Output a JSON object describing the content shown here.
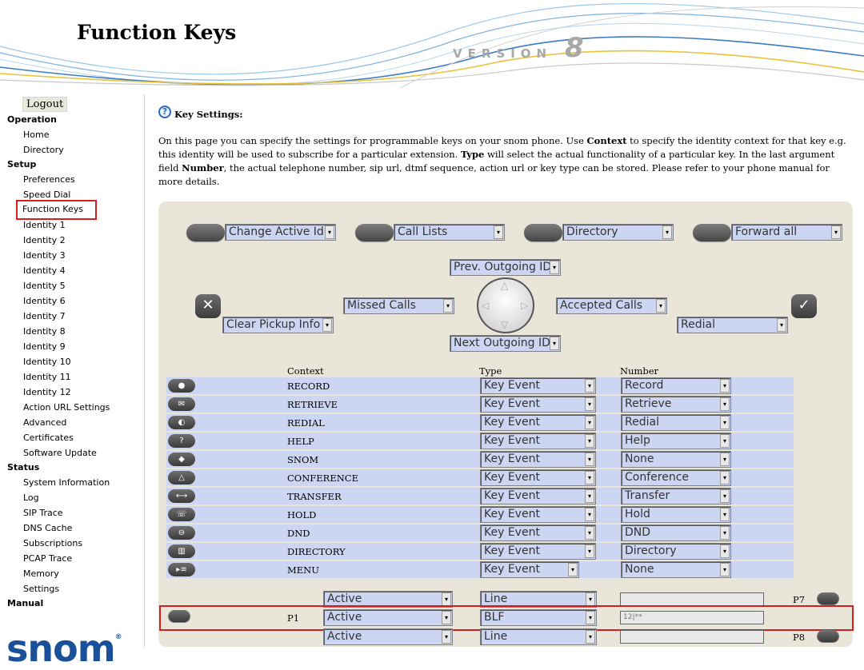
{
  "header": {
    "title": "Function Keys",
    "version_label": "VERSION",
    "version_number": "8"
  },
  "sidebar": {
    "logout": "Logout",
    "operation": {
      "label": "Operation",
      "items": [
        "Home",
        "Directory"
      ]
    },
    "setup": {
      "label": "Setup",
      "items": [
        "Preferences",
        "Speed Dial",
        "Function Keys",
        "Identity 1",
        "Identity 2",
        "Identity 3",
        "Identity 4",
        "Identity 5",
        "Identity 6",
        "Identity 7",
        "Identity 8",
        "Identity 9",
        "Identity 10",
        "Identity 11",
        "Identity 12",
        "Action URL Settings",
        "Advanced",
        "Certificates",
        "Software Update"
      ]
    },
    "status": {
      "label": "Status",
      "items": [
        "System Information",
        "Log",
        "SIP Trace",
        "DNS Cache",
        "Subscriptions",
        "PCAP Trace",
        "Memory",
        "Settings"
      ]
    },
    "manual": {
      "label": "Manual"
    },
    "logo": "snom"
  },
  "main": {
    "section_title": "Key Settings:",
    "desc_1": "On this page you can specify the settings for programmable keys on your snom phone. Use ",
    "desc_b1": "Context",
    "desc_2": " to specify the identity context for that key e.g. this identity will be used to subscribe for a particular extension. ",
    "desc_b2": "Type",
    "desc_3": " will select the actual functionality of a particular key. In the last argument field ",
    "desc_b3": "Number",
    "desc_4": ", the actual telephone number, sip url, dtmf sequence, action url or key type can be stored. Please refer to your phone manual for more details."
  },
  "softkeys": [
    "Change Active Id",
    "Call Lists",
    "Directory",
    "Forward all"
  ],
  "navkeys": {
    "up": "Prev. Outgoing ID",
    "down": "Next Outgoing ID",
    "left": "Missed Calls",
    "right": "Accepted Calls",
    "cancel": "Clear Pickup Info",
    "ok": "Redial",
    "cancel_symbol": "✕",
    "ok_symbol": "✓"
  },
  "columns": {
    "context": "Context",
    "type": "Type",
    "number": "Number"
  },
  "keys": [
    {
      "name": "RECORD",
      "type": "Key Event",
      "number": "Record",
      "icon": "record-icon"
    },
    {
      "name": "RETRIEVE",
      "type": "Key Event",
      "number": "Retrieve",
      "icon": "envelope-icon"
    },
    {
      "name": "REDIAL",
      "type": "Key Event",
      "number": "Redial",
      "icon": "redial-icon"
    },
    {
      "name": "HELP",
      "type": "Key Event",
      "number": "Help",
      "icon": "help-icon"
    },
    {
      "name": "SNOM",
      "type": "Key Event",
      "number": "None",
      "icon": "snom-icon"
    },
    {
      "name": "CONFERENCE",
      "type": "Key Event",
      "number": "Conference",
      "icon": "conference-icon"
    },
    {
      "name": "TRANSFER",
      "type": "Key Event",
      "number": "Transfer",
      "icon": "transfer-icon"
    },
    {
      "name": "HOLD",
      "type": "Key Event",
      "number": "Hold",
      "icon": "hold-icon"
    },
    {
      "name": "DND",
      "type": "Key Event",
      "number": "DND",
      "icon": "dnd-icon"
    },
    {
      "name": "DIRECTORY",
      "type": "Key Event",
      "number": "Directory",
      "icon": "book-icon"
    },
    {
      "name": "MENU",
      "type": "Key Event",
      "number": "None",
      "icon": "menu-icon"
    }
  ],
  "pkeys": [
    {
      "label": "P7",
      "context": "Active",
      "type": "Line",
      "number": ""
    },
    {
      "label": "P1",
      "context": "Active",
      "type": "BLF",
      "number": "12|**"
    },
    {
      "label": "P8",
      "context": "Active",
      "type": "Line",
      "number": ""
    }
  ]
}
